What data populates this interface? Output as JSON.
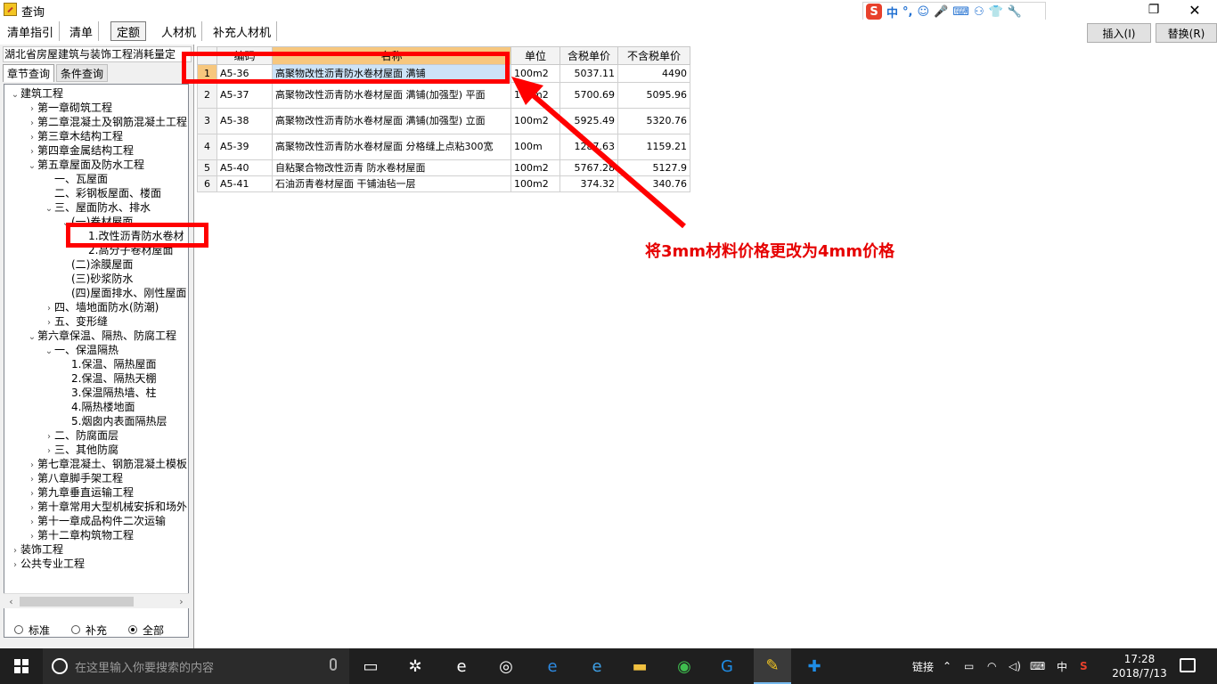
{
  "window": {
    "title": "查询",
    "restore_icon": "restore-icon",
    "close_icon": "close-icon",
    "close_glyph": "✕",
    "restore_glyph": "❐"
  },
  "ime": {
    "logo": "S",
    "items": [
      "中",
      "°,",
      "☺",
      "🎤",
      "⌨",
      "⚇",
      "👕",
      "🔧"
    ]
  },
  "tabs": [
    "清单指引",
    "清单",
    "定额",
    "人材机",
    "补充人材机"
  ],
  "active_tab": "定额",
  "buttons": {
    "insert": "插入(I)",
    "replace": "替换(R)"
  },
  "left_panel": {
    "title": "湖北省房屋建筑与装饰工程消耗量定",
    "subtabs": [
      "章节查询",
      "条件查询"
    ],
    "tree": [
      {
        "level": 0,
        "exp": "⌄",
        "label": "建筑工程"
      },
      {
        "level": 1,
        "exp": "›",
        "label": "第一章砌筑工程"
      },
      {
        "level": 1,
        "exp": "›",
        "label": "第二章混凝土及钢筋混凝土工程"
      },
      {
        "level": 1,
        "exp": "›",
        "label": "第三章木结构工程"
      },
      {
        "level": 1,
        "exp": "›",
        "label": "第四章金属结构工程"
      },
      {
        "level": 1,
        "exp": "⌄",
        "label": "第五章屋面及防水工程"
      },
      {
        "level": 2,
        "exp": "",
        "label": "一、瓦屋面"
      },
      {
        "level": 2,
        "exp": "",
        "label": "二、彩钢板屋面、楼面"
      },
      {
        "level": 2,
        "exp": "⌄",
        "label": "三、屋面防水、排水"
      },
      {
        "level": 3,
        "exp": "⌄",
        "label": "(一)卷材屋面"
      },
      {
        "level": 4,
        "exp": "",
        "label": "1.改性沥青防水卷材"
      },
      {
        "level": 4,
        "exp": "",
        "label": "2.高分子卷材屋面"
      },
      {
        "level": 3,
        "exp": "",
        "label": "(二)涂膜屋面"
      },
      {
        "level": 3,
        "exp": "",
        "label": "(三)砂浆防水"
      },
      {
        "level": 3,
        "exp": "",
        "label": "(四)屋面排水、刚性屋面"
      },
      {
        "level": 2,
        "exp": "›",
        "label": "四、墙地面防水(防潮)"
      },
      {
        "level": 2,
        "exp": "›",
        "label": "五、变形缝"
      },
      {
        "level": 1,
        "exp": "⌄",
        "label": "第六章保温、隔热、防腐工程"
      },
      {
        "level": 2,
        "exp": "⌄",
        "label": "一、保温隔热"
      },
      {
        "level": 3,
        "exp": "",
        "label": "1.保温、隔热屋面"
      },
      {
        "level": 3,
        "exp": "",
        "label": "2.保温、隔热天棚"
      },
      {
        "level": 3,
        "exp": "",
        "label": "3.保温隔热墙、柱"
      },
      {
        "level": 3,
        "exp": "",
        "label": "4.隔热楼地面"
      },
      {
        "level": 3,
        "exp": "",
        "label": "5.烟囱内表面隔热层"
      },
      {
        "level": 2,
        "exp": "›",
        "label": "二、防腐面层"
      },
      {
        "level": 2,
        "exp": "›",
        "label": "三、其他防腐"
      },
      {
        "level": 1,
        "exp": "›",
        "label": "第七章混凝土、钢筋混凝土模板"
      },
      {
        "level": 1,
        "exp": "›",
        "label": "第八章脚手架工程"
      },
      {
        "level": 1,
        "exp": "›",
        "label": "第九章垂直运输工程"
      },
      {
        "level": 1,
        "exp": "›",
        "label": "第十章常用大型机械安拆和场外"
      },
      {
        "level": 1,
        "exp": "›",
        "label": "第十一章成品构件二次运输"
      },
      {
        "level": 1,
        "exp": "›",
        "label": "第十二章构筑物工程"
      },
      {
        "level": 0,
        "exp": "›",
        "label": "装饰工程"
      },
      {
        "level": 0,
        "exp": "›",
        "label": "公共专业工程"
      }
    ],
    "radios": [
      {
        "label": "标准",
        "checked": false
      },
      {
        "label": "补充",
        "checked": false
      },
      {
        "label": "全部",
        "checked": true
      }
    ]
  },
  "grid": {
    "headers": [
      "",
      "编码",
      "名称",
      "单位",
      "含税单价",
      "不含税单价"
    ],
    "rows": [
      {
        "idx": "1",
        "code": "A5-36",
        "name": "高聚物改性沥青防水卷材屋面 满铺",
        "unit": "100m2",
        "tax": "5037.11",
        "notax": "4490",
        "selected": true
      },
      {
        "idx": "2",
        "code": "A5-37",
        "name": "高聚物改性沥青防水卷材屋面 满铺(加强型) 平面",
        "unit": "100m2",
        "tax": "5700.69",
        "notax": "5095.96"
      },
      {
        "idx": "3",
        "code": "A5-38",
        "name": "高聚物改性沥青防水卷材屋面 满铺(加强型) 立面",
        "unit": "100m2",
        "tax": "5925.49",
        "notax": "5320.76"
      },
      {
        "idx": "4",
        "code": "A5-39",
        "name": "高聚物改性沥青防水卷材屋面 分格缝上点粘300宽",
        "unit": "100m",
        "tax": "1287.63",
        "notax": "1159.21"
      },
      {
        "idx": "5",
        "code": "A5-40",
        "name": "自粘聚合物改性沥青 防水卷材屋面",
        "unit": "100m2",
        "tax": "5767.28",
        "notax": "5127.9"
      },
      {
        "idx": "6",
        "code": "A5-41",
        "name": "石油沥青卷材屋面 干铺油毡一层",
        "unit": "100m2",
        "tax": "374.32",
        "notax": "340.76"
      }
    ]
  },
  "annotation": {
    "text": "将3mm材料价格更改为4mm价格",
    "color": "#ff0000"
  },
  "taskbar": {
    "search_placeholder": "在这里输入你要搜索的内容",
    "tray_link": "链接",
    "tray_lang": "中",
    "time": "17:28",
    "date": "2018/7/13"
  }
}
